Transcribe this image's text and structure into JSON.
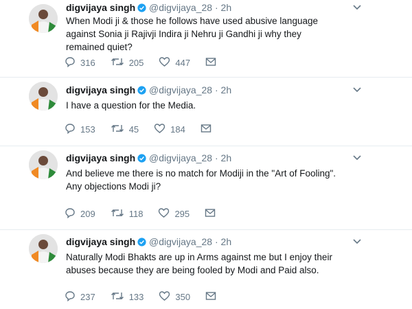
{
  "tweets": [
    {
      "name": "digvijaya singh",
      "handle": "@digvijaya_28",
      "dot": "·",
      "time": "2h",
      "text": "When Modi ji & those he follows have used abusive language against Sonia ji Rajivji Indira ji Nehru ji Gandhi ji why they remained quiet?",
      "replies": "316",
      "retweets": "205",
      "likes": "447"
    },
    {
      "name": "digvijaya singh",
      "handle": "@digvijaya_28",
      "dot": "·",
      "time": "2h",
      "text": "I have a question for the Media.",
      "replies": "153",
      "retweets": "45",
      "likes": "184"
    },
    {
      "name": "digvijaya singh",
      "handle": "@digvijaya_28",
      "dot": "·",
      "time": "2h",
      "text": "And believe me there is no match for Modiji in the \"Art of Fooling\". Any objections Modi ji?",
      "replies": "209",
      "retweets": "118",
      "likes": "295"
    },
    {
      "name": "digvijaya singh",
      "handle": "@digvijaya_28",
      "dot": "·",
      "time": "2h",
      "text": "Naturally Modi Bhakts are up in Arms against me but I enjoy their abuses because they are being fooled by Modi and Paid also.",
      "replies": "237",
      "retweets": "133",
      "likes": "350"
    }
  ],
  "icons": {
    "reply": "reply-icon",
    "retweet": "retweet-icon",
    "like": "heart-icon",
    "message": "envelope-icon",
    "verified": "verified-badge-icon",
    "caret": "chevron-down-icon"
  },
  "colors": {
    "verified": "#1da1f2",
    "muted": "#657786",
    "divider": "#e6ecf0"
  }
}
